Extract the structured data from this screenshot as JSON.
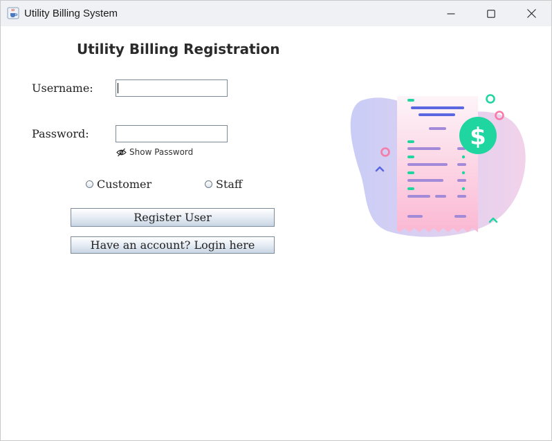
{
  "window": {
    "title": "Utility Billing System",
    "app_icon": "java-cup-icon",
    "controls": [
      "minimize-icon",
      "maximize-icon",
      "close-icon"
    ]
  },
  "form": {
    "heading": "Utility Billing Registration",
    "username_label": "Username:",
    "username_value": "",
    "password_label": "Password:",
    "password_value": "",
    "show_password_label": "Show Password",
    "show_password_icon": "eye-slash-icon",
    "role_options": [
      "Customer",
      "Staff"
    ],
    "register_button": "Register User",
    "login_button": "Have an account? Login here"
  },
  "illustration": {
    "icon": "bill-receipt-dollar-icon",
    "colors": {
      "blob": "#cfcdf6",
      "receipt": "#fdd5e7",
      "accent_green": "#1fd6a0",
      "accent_pink": "#f77aa8",
      "accent_purple": "#a38ad8",
      "accent_blue": "#5a67e0"
    }
  }
}
